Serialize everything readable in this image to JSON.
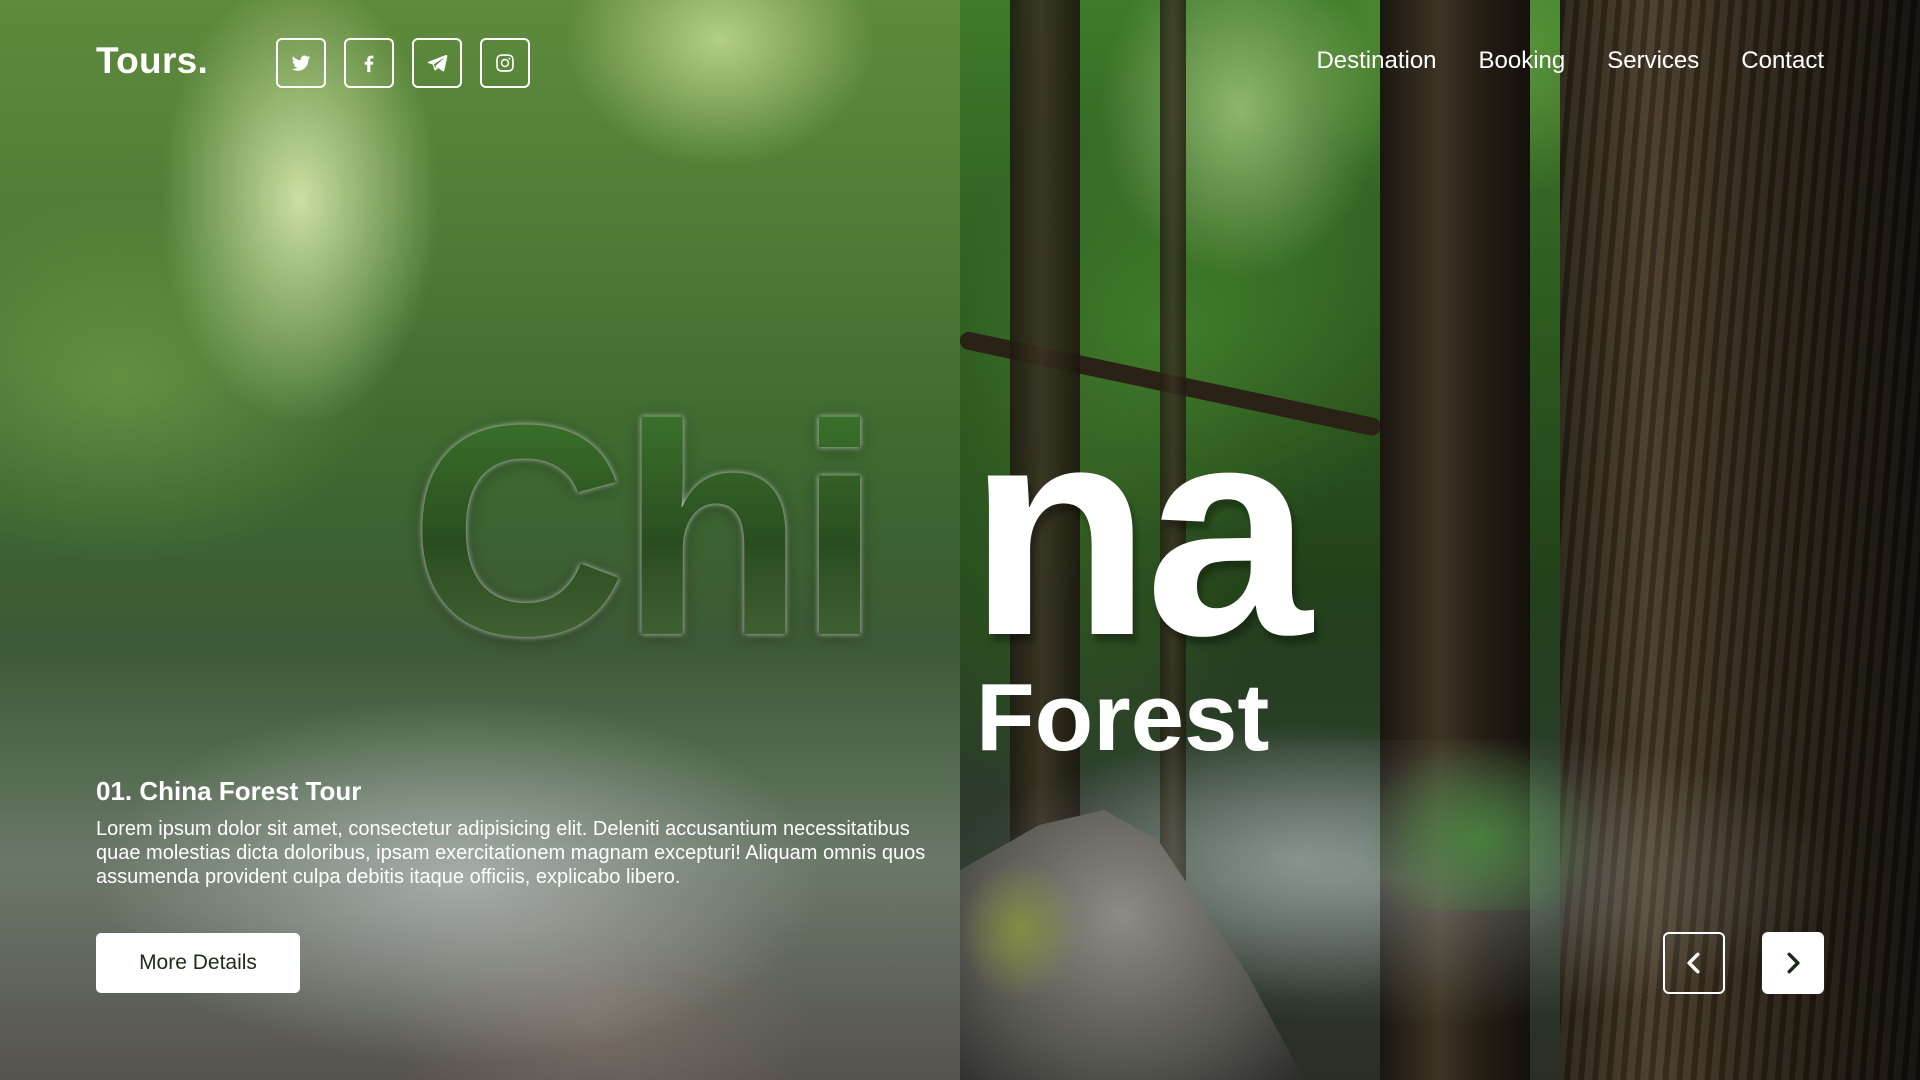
{
  "brand": {
    "logo": "Tours."
  },
  "socials": [
    {
      "icon": "twitter-icon"
    },
    {
      "icon": "facebook-icon"
    },
    {
      "icon": "telegram-icon"
    },
    {
      "icon": "instagram-icon"
    }
  ],
  "nav": {
    "items": [
      "Destination",
      "Booking",
      "Services",
      "Contact"
    ]
  },
  "hero": {
    "title_part1": "Chi",
    "title_part2": "na",
    "subtitle": "Forest"
  },
  "tour": {
    "title": "01. China Forest Tour",
    "description": "Lorem ipsum dolor sit amet, consectetur adipisicing elit. Deleniti accusantium necessitatibus quae molestias dicta doloribus, ipsam exercitationem magnam excepturi! Aliquam omnis quos assumenda provident culpa debitis itaque officiis, explicabo libero.",
    "button_label": "More Details"
  },
  "slider": {
    "prev_icon": "chevron-left-icon",
    "next_icon": "chevron-right-icon"
  },
  "colors": {
    "text": "#ffffff",
    "button_bg": "#ffffff",
    "button_text": "#1f2a1a"
  }
}
